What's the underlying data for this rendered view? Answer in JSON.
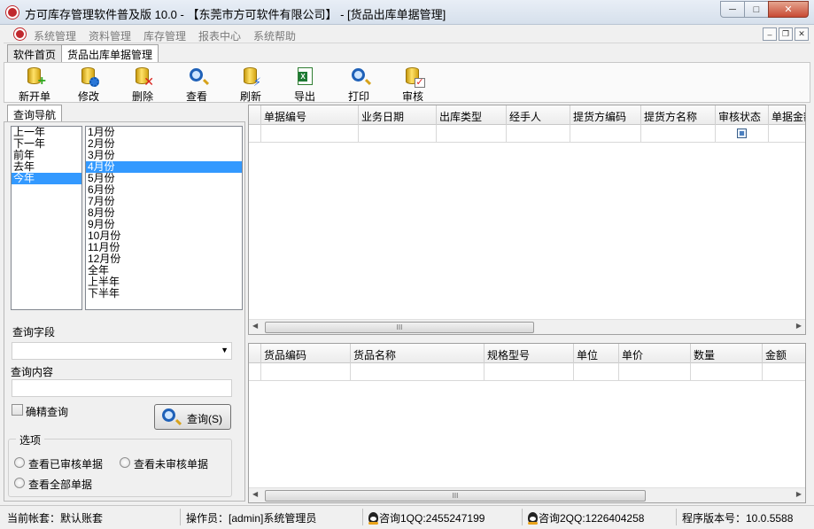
{
  "window": {
    "title": "方可库存管理软件普及版 10.0 - 【东莞市方可软件有限公司】 - [货品出库单据管理]",
    "minimize": "─",
    "maximize": "□",
    "close": "✕"
  },
  "menu": {
    "items": [
      "系统管理",
      "资料管理",
      "库存管理",
      "报表中心",
      "系统帮助"
    ],
    "mdi_min": "–",
    "mdi_restore": "❐",
    "mdi_close": "✕"
  },
  "tabs": [
    "软件首页",
    "货品出库单据管理"
  ],
  "toolbar": {
    "new": "新开单",
    "edit": "修改",
    "delete": "删除",
    "view": "查看",
    "refresh": "刷新",
    "export": "导出",
    "print": "打印",
    "audit": "审核"
  },
  "nav": {
    "tab": "查询导航",
    "years": [
      "上一年",
      "下一年",
      "前年",
      "去年",
      "今年"
    ],
    "selected_year": "今年",
    "months": [
      "1月份",
      "2月份",
      "3月份",
      "4月份",
      "5月份",
      "6月份",
      "7月份",
      "8月份",
      "9月份",
      "10月份",
      "11月份",
      "12月份",
      "全年",
      "上半年",
      "下半年"
    ],
    "selected_month": "4月份",
    "query_field_label": "查询字段",
    "query_field_value": "",
    "query_content_label": "查询内容",
    "query_content_value": "",
    "exact_query_label": "确精查询",
    "query_button": "查询(S)",
    "options_label": "选项",
    "opt_audited": "查看已审核单据",
    "opt_unaudited": "查看未审核单据",
    "opt_all": "查看全部单据"
  },
  "main_grid": {
    "columns": [
      "单据编号",
      "业务日期",
      "出库类型",
      "经手人",
      "提货方编码",
      "提货方名称",
      "审核状态",
      "单据金额"
    ]
  },
  "detail_grid": {
    "columns": [
      "货品编码",
      "货品名称",
      "规格型号",
      "单位",
      "单价",
      "数量",
      "金额"
    ]
  },
  "scroll": {
    "grip": "III",
    "left": "◀",
    "right": "▶"
  },
  "status": {
    "account": "当前帐套：默认账套",
    "operator": "操作员：[admin]系统管理员",
    "qq1": "咨询1QQ:2455247199",
    "qq2": "咨询2QQ:1226404258",
    "version": "程序版本号：10.0.5588"
  }
}
